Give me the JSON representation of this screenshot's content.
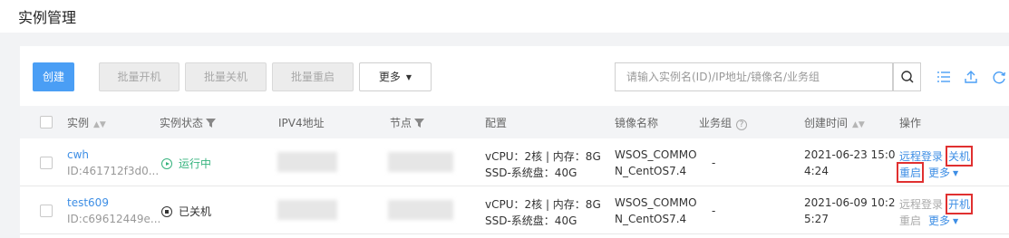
{
  "page": {
    "title": "实例管理"
  },
  "toolbar": {
    "create": "创建",
    "batch_start": "批量开机",
    "batch_stop": "批量关机",
    "batch_restart": "批量重启",
    "more": "更多",
    "search_placeholder": "请输入实例名(ID)/IP地址/镜像名/业务组"
  },
  "table": {
    "headers": {
      "instance": "实例",
      "status": "实例状态",
      "ipv4": "IPV4地址",
      "node": "节点",
      "config": "配置",
      "image": "镜像名称",
      "business_group": "业务组",
      "created": "创建时间",
      "actions": "操作"
    },
    "rows": [
      {
        "name": "cwh",
        "id": "ID:461712f3d0...",
        "status": "运行中",
        "config_line1": "vCPU：2核 | 内存：8G",
        "config_line2": "SSD-系统盘：40G",
        "image_line1": "WSOS_COMMO",
        "image_line2": "N_CentOS7.4",
        "business_group": "-",
        "created_line1": "2021-06-23 15:0",
        "created_line2": "4:24",
        "action_remote": "远程登录",
        "action_power": "关机",
        "action_restart": "重启",
        "action_more": "更多"
      },
      {
        "name": "test609",
        "id": "ID:c69612449e...",
        "status": "已关机",
        "config_line1": "vCPU：2核 | 内存：8G",
        "config_line2": "SSD-系统盘：40G",
        "image_line1": "WSOS_COMMO",
        "image_line2": "N_CentOS7.4",
        "business_group": "-",
        "created_line1": "2021-06-09 10:2",
        "created_line2": "5:27",
        "action_remote": "远程登录",
        "action_power": "开机",
        "action_restart": "重启",
        "action_more": "更多"
      }
    ]
  },
  "colors": {
    "primary": "#4a9ef5",
    "link": "#3d8ee5",
    "running": "#36b37e",
    "highlight": "#e03030"
  },
  "icons": [
    "search-icon",
    "column-settings-icon",
    "export-icon",
    "refresh-icon",
    "sort-icon",
    "filter-icon",
    "help-icon",
    "running-status-icon",
    "stopped-status-icon"
  ]
}
